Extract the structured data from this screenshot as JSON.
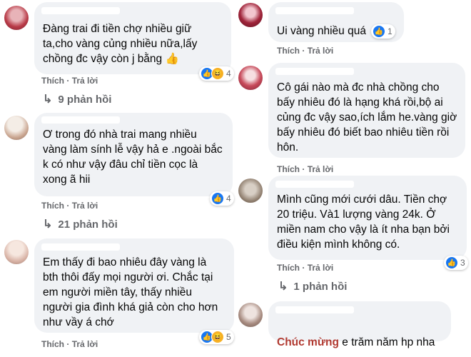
{
  "actions": {
    "like": "Thích",
    "reply": "Trả lời"
  },
  "left": [
    {
      "text": "Đàng trai đi tiền chợ nhiều giữ\nta,cho vàng củng nhiều nữa,lấy\nchồng đc vậy còn j bằng 👍",
      "reaction_count": "4",
      "replies": "9 phản hồi"
    },
    {
      "text": "Ơ trong đó nhà trai mang nhiều\nvàng làm sính lễ vậy hả e .ngoài bắc\nk có như vậy đâu chỉ tiền cọc là\nxong ã hii",
      "reaction_count": "4",
      "replies": "21 phản hồi"
    },
    {
      "text": "Em thấy đi bao nhiêu đây vàng là\nbth thôi đấy mọi người ơi. Chắc tại\nem người miền tây, thấy nhiều\nngười gia đình khá giả còn cho hơn\nnhư vầy á chớ",
      "reaction_count": "5"
    }
  ],
  "right": [
    {
      "text": "Ui vàng nhiều quá",
      "reaction_count": "1"
    },
    {
      "text": "Cô gái nào mà đc nhà chồng cho\nbấy nhiêu đó là hạng khá rồi,bộ ai\ncủng đc vậy sao,ích lắm he.vàng giờ\nbấy nhiêu đó biết bao nhiêu tiền rồi\nhôn."
    },
    {
      "text": "Mình cũng mới cưới dâu. Tiền chợ\n20 triệu. Và1 lượng vàng 24k. Ở\nmiền nam cho vậy là ít nha bạn bởi\nđiều kiện mình không có.",
      "reaction_count": "3",
      "replies": "1 phản hồi"
    },
    {
      "highlight": "Chúc mừng",
      "text": " e trăm năm hp nha"
    }
  ],
  "colors": {
    "bubble": "#f0f2f5",
    "action_text": "#65676b",
    "like_blue": "#1877f2",
    "haha_yellow": "#f7b125",
    "highlight_red": "#b13a31"
  },
  "icons": [
    "like-icon",
    "haha-icon",
    "reply-arrow-icon"
  ]
}
